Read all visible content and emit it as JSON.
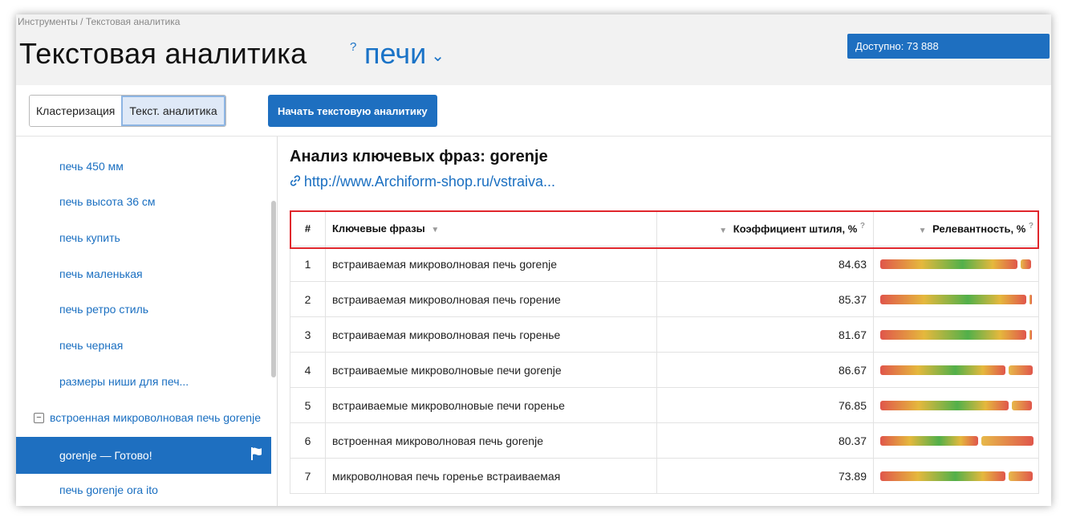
{
  "breadcrumb": "Инструменты / Текстовая аналитика",
  "header": {
    "title": "Текстовая аналитика",
    "help": "?",
    "project": "печи",
    "chevron": "⌄",
    "available": "Доступно: 73 888"
  },
  "toolbar": {
    "tabs": [
      {
        "label": "Кластеризация",
        "active": false
      },
      {
        "label": "Текст. аналитика",
        "active": true
      }
    ],
    "start_button": "Начать текстовую аналитику"
  },
  "sidebar": {
    "items": [
      {
        "label": "печь 450 мм"
      },
      {
        "label": "печь высота 36 см"
      },
      {
        "label": "печь купить"
      },
      {
        "label": "печь маленькая"
      },
      {
        "label": "печь ретро стиль"
      },
      {
        "label": "печь черная"
      },
      {
        "label": "размеры ниши для печ..."
      },
      {
        "label": "встроенная микроволновая печь gorenje",
        "toggle": "−"
      },
      {
        "label": "gorenje — Готово!",
        "selected": true
      },
      {
        "label": "печь gorenje ora ito"
      }
    ]
  },
  "content": {
    "heading": "Анализ ключевых фраз: gorenje",
    "link_icon": "🔗",
    "link": "http://www.Archiform-shop.ru/vstraiva..."
  },
  "table": {
    "columns": {
      "num": "#",
      "phrase": "Ключевые фразы",
      "coef": "Коэффициент штиля, %",
      "rel": "Релевантность, %"
    },
    "sort_glyph": "▼",
    "help_glyph": "?",
    "rows": [
      {
        "num": "1",
        "phrase": "встраиваемая микроволновая печь gorenje",
        "coef": "84.63",
        "bar": 0.9,
        "tail": 0.07
      },
      {
        "num": "2",
        "phrase": "встраиваемая микроволновая печь горение",
        "coef": "85.37",
        "bar": 0.96,
        "tail": 0.01
      },
      {
        "num": "3",
        "phrase": "встраиваемая микроволновая печь горенье",
        "coef": "81.67",
        "bar": 0.96,
        "tail": 0.01
      },
      {
        "num": "4",
        "phrase": "встраиваемые микроволновые печи gorenje",
        "coef": "86.67",
        "bar": 0.82,
        "tail": 0.16
      },
      {
        "num": "5",
        "phrase": "встраиваемые микроволновые печи горенье",
        "coef": "76.85",
        "bar": 0.84,
        "tail": 0.13
      },
      {
        "num": "6",
        "phrase": "встроенная микроволновая печь gorenje",
        "coef": "80.37",
        "bar": 0.64,
        "tail": 0.34
      },
      {
        "num": "7",
        "phrase": "микроволновая печь горенье встраиваемая",
        "coef": "73.89",
        "bar": 0.82,
        "tail": 0.16
      }
    ]
  }
}
